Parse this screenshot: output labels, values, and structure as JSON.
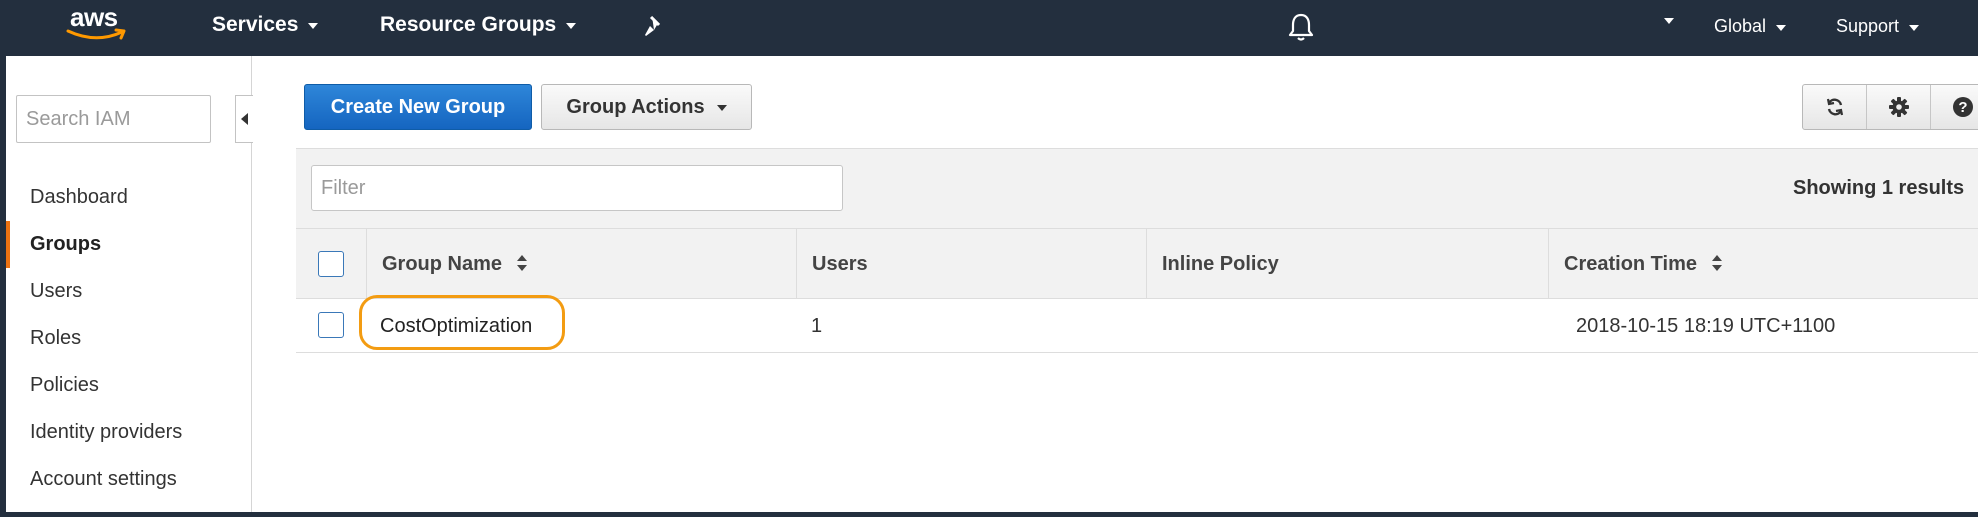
{
  "topnav": {
    "logo_text": "aws",
    "services_label": "Services",
    "resource_groups_label": "Resource Groups",
    "region_label": "Global",
    "support_label": "Support"
  },
  "sidebar": {
    "search_placeholder": "Search IAM",
    "items": [
      {
        "label": "Dashboard"
      },
      {
        "label": "Groups"
      },
      {
        "label": "Users"
      },
      {
        "label": "Roles"
      },
      {
        "label": "Policies"
      },
      {
        "label": "Identity providers"
      },
      {
        "label": "Account settings"
      }
    ],
    "active_item": "Groups"
  },
  "toolbar": {
    "create_label": "Create New Group",
    "actions_label": "Group Actions",
    "icons": [
      "refresh-icon",
      "gear-icon",
      "help-icon"
    ]
  },
  "table": {
    "filter_placeholder": "Filter",
    "results_text": "Showing 1 results",
    "columns": [
      "Group Name",
      "Users",
      "Inline Policy",
      "Creation Time"
    ],
    "rows": [
      {
        "group_name": "CostOptimization",
        "users": "1",
        "inline_policy": "",
        "creation_time": "2018-10-15 18:19 UTC+1100"
      }
    ]
  },
  "colors": {
    "nav_bg": "#232f3e",
    "primary_button": "#1a73c8",
    "active_accent": "#ec7211",
    "highlight_ring": "#f39c12"
  }
}
